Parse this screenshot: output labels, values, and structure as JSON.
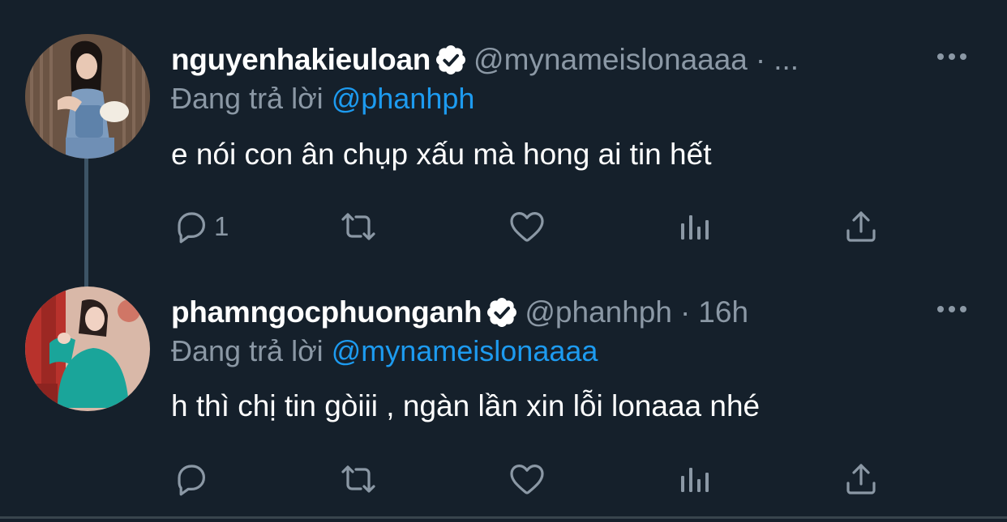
{
  "colors": {
    "background": "#15202b",
    "text_primary": "#ffffff",
    "text_secondary": "#8b98a5",
    "mention": "#1d9bf0",
    "thread_line": "#3d5466"
  },
  "tweets": [
    {
      "display_name": "nguyenhakieuloan",
      "verified": true,
      "handle": "@mynameislonaaaa",
      "separator": "·",
      "time": "...",
      "reply_prefix": "Đang trả lời",
      "reply_mention": "@phanhph",
      "text": "e nói con ân chụp xấu mà hong ai tin hết",
      "reply_count": "1",
      "icons": [
        "reply-icon",
        "retweet-icon",
        "like-icon",
        "analytics-icon",
        "share-icon",
        "more-icon"
      ]
    },
    {
      "display_name": "phamngocphuonganh",
      "verified": true,
      "handle": "@phanhph",
      "separator": "·",
      "time": "16h",
      "reply_prefix": "Đang trả lời",
      "reply_mention": "@mynameislonaaaa",
      "text": "h thì chị tin gòiii , ngàn lần xin lỗi lonaaa nhé",
      "reply_count": "",
      "icons": [
        "reply-icon",
        "retweet-icon",
        "like-icon",
        "analytics-icon",
        "share-icon",
        "more-icon"
      ]
    }
  ]
}
